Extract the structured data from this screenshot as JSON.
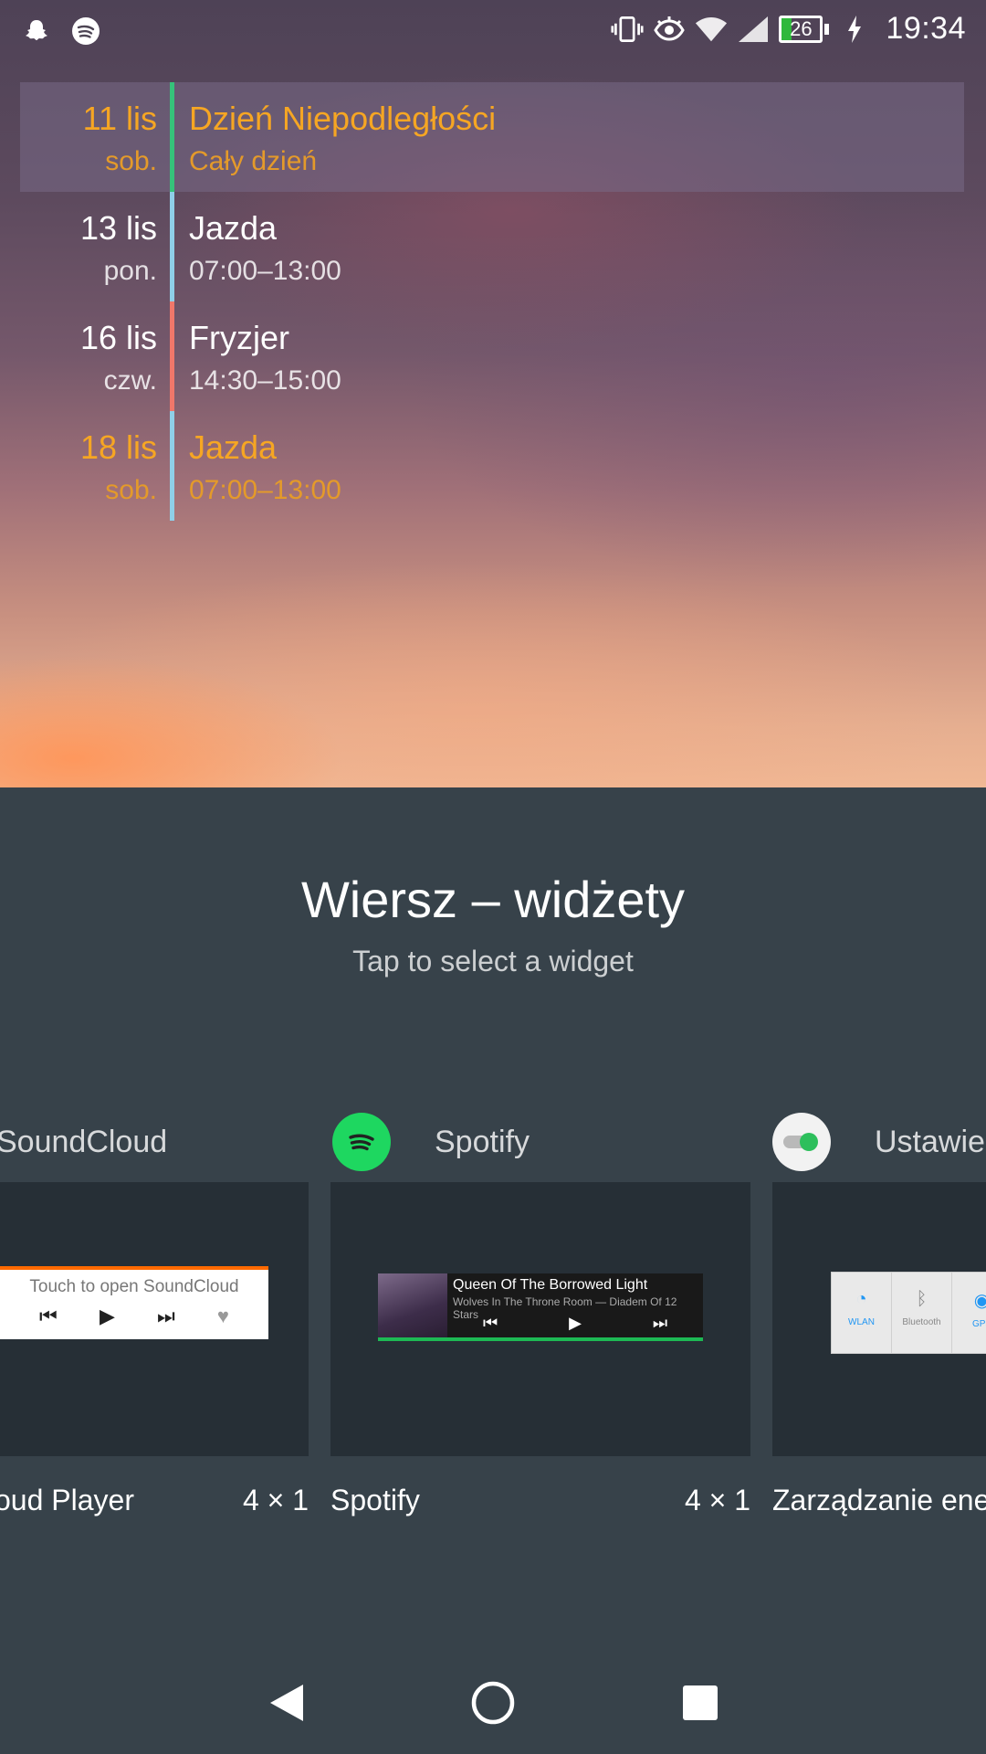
{
  "status_bar": {
    "left_icons": [
      "snapchat-icon",
      "spotify-icon"
    ],
    "right_icons": [
      "vibrate-icon",
      "eye-icon",
      "wifi-icon",
      "signal-icon"
    ],
    "battery_level": "26",
    "battery_fill_percent": 26,
    "charging": true,
    "time": "19:34"
  },
  "agenda": {
    "events": [
      {
        "day": "11 lis",
        "weekday": "sob.",
        "title": "Dzień Niepodległości",
        "time": "Cały dzień",
        "bar_color": "#36c27a",
        "highlight": true,
        "text_color": "orange"
      },
      {
        "day": "13 lis",
        "weekday": "pon.",
        "title": "Jazda",
        "time": "07:00–13:00",
        "bar_color": "#8fcfe8",
        "highlight": false,
        "text_color": "white"
      },
      {
        "day": "16 lis",
        "weekday": "czw.",
        "title": "Fryzjer",
        "time": "14:30–15:00",
        "bar_color": "#f0776a",
        "highlight": false,
        "text_color": "white"
      },
      {
        "day": "18 lis",
        "weekday": "sob.",
        "title": "Jazda",
        "time": "07:00–13:00",
        "bar_color": "#8fcfe8",
        "highlight": false,
        "text_color": "orange"
      }
    ]
  },
  "picker": {
    "title": "Wiersz – widżety",
    "subtitle": "Tap to select a widget",
    "apps": [
      {
        "app_name": "SoundCloud",
        "widget_name": "oud Player",
        "size": "4 × 1",
        "preview_text": "Touch to open SoundCloud"
      },
      {
        "app_name": "Spotify",
        "widget_name": "Spotify",
        "size": "4 × 1",
        "track": "Queen Of The Borrowed Light",
        "artist": "Wolves In The Throne Room — Diadem Of 12 Stars"
      },
      {
        "app_name": "Ustawie",
        "widget_name": "Zarządzanie energ",
        "size": "",
        "tiles": [
          "WLAN",
          "Bluetooth",
          "GPS"
        ]
      }
    ]
  },
  "nav": {
    "buttons": [
      "back-icon",
      "home-icon",
      "recents-icon"
    ]
  }
}
